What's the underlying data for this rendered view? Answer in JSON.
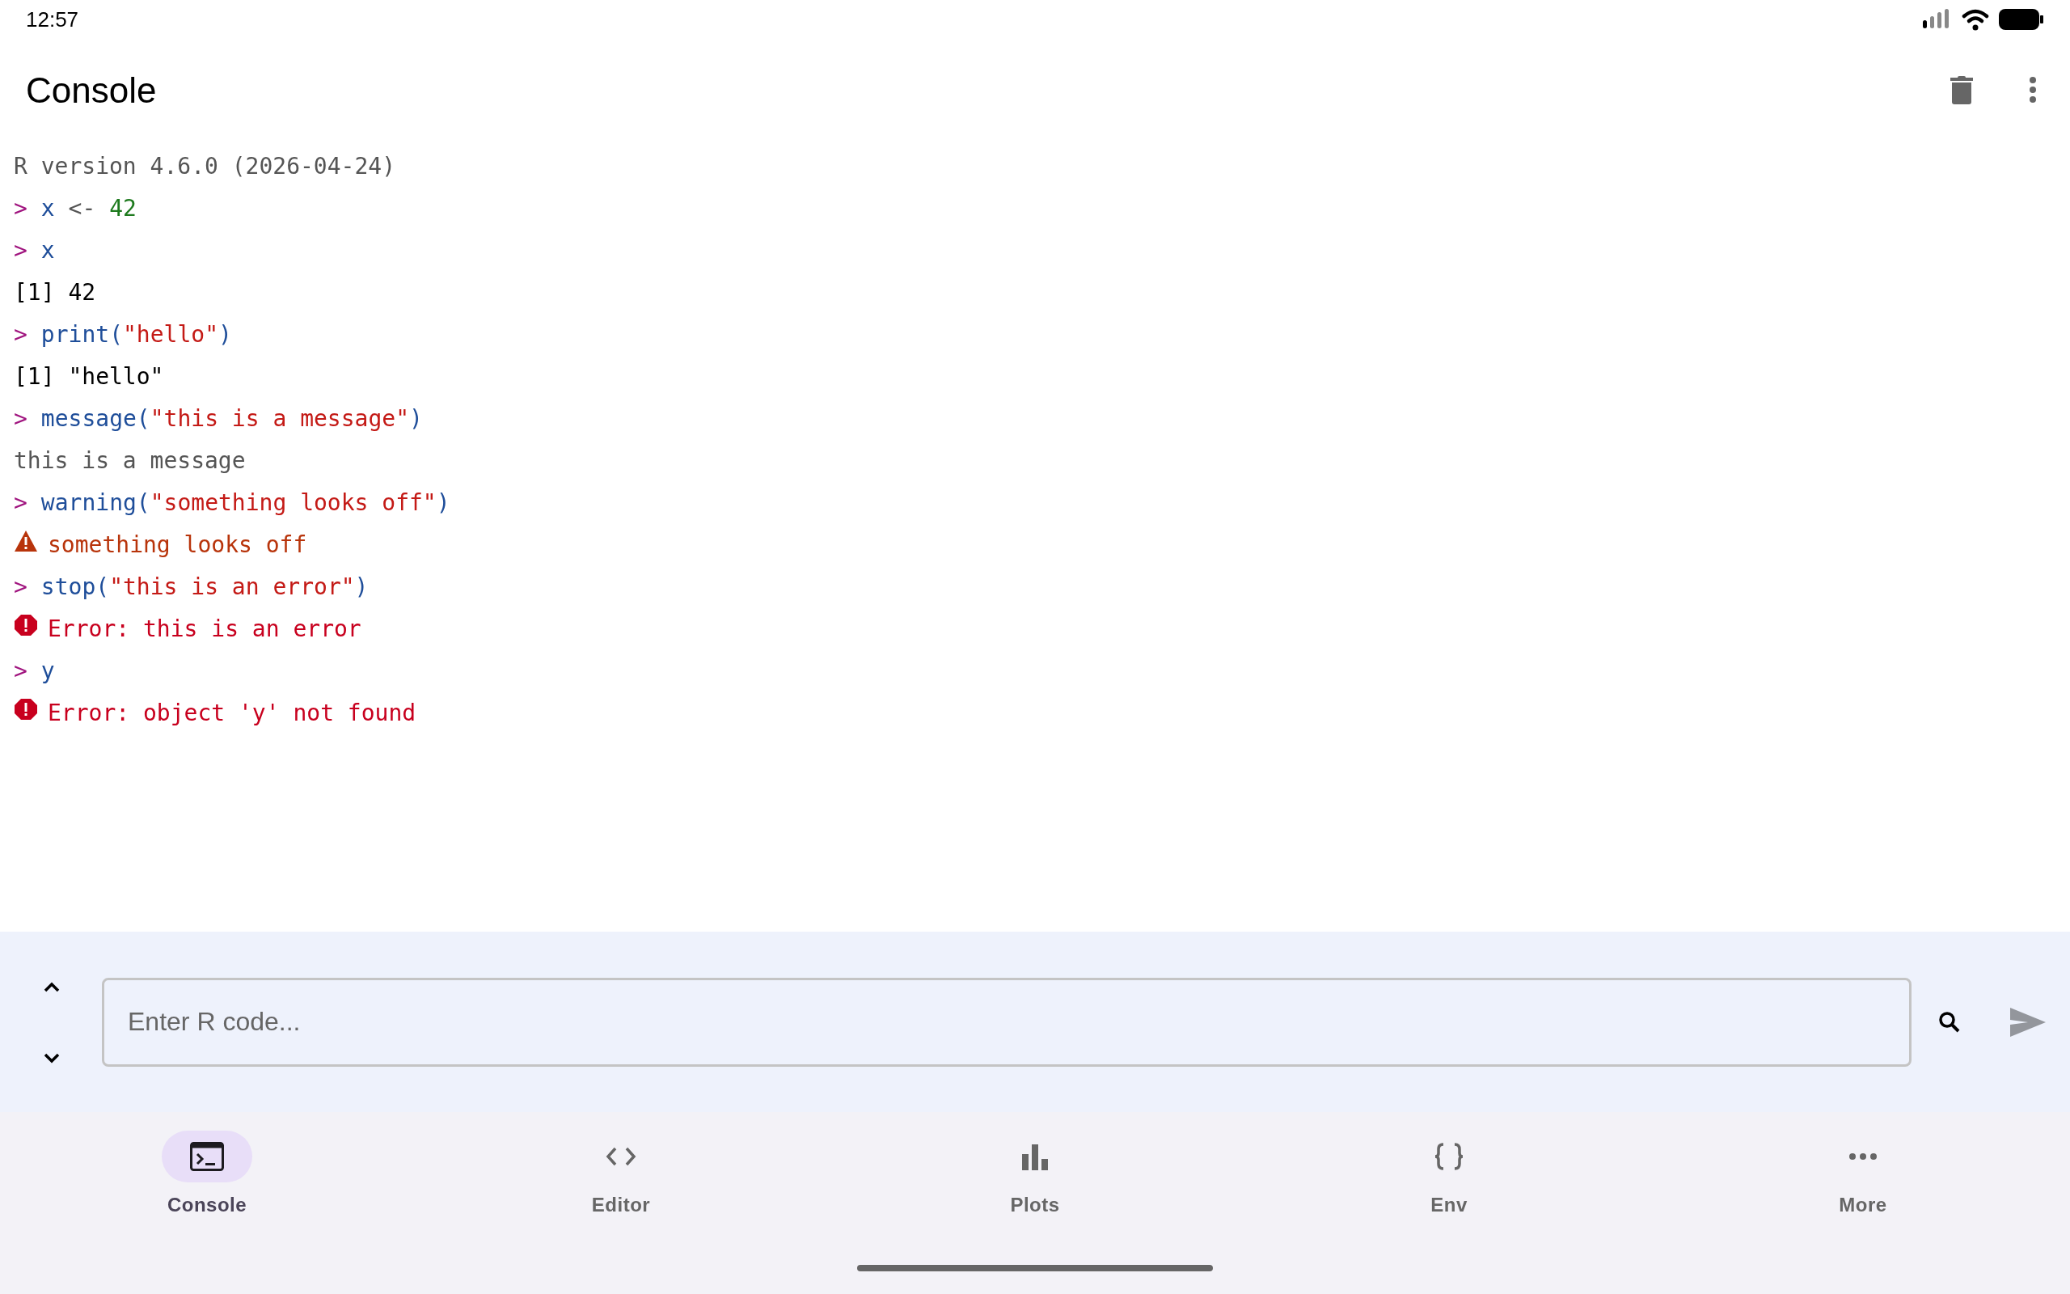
{
  "status_bar": {
    "time": "12:57"
  },
  "app_bar": {
    "title": "Console"
  },
  "console": [
    {
      "kind": "info",
      "text": "R version 4.6.0 (2026-04-24)"
    },
    {
      "kind": "input",
      "prompt": ">",
      "tokens": [
        {
          "kind": "code",
          "text": "x"
        },
        {
          "kind": "op",
          "text": " <- "
        },
        {
          "kind": "number",
          "text": "42"
        }
      ]
    },
    {
      "kind": "input",
      "prompt": ">",
      "tokens": [
        {
          "kind": "code",
          "text": "x"
        }
      ]
    },
    {
      "kind": "output",
      "text": "[1] 42"
    },
    {
      "kind": "input",
      "prompt": ">",
      "tokens": [
        {
          "kind": "code",
          "text": "print("
        },
        {
          "kind": "string",
          "text": "\"hello\""
        },
        {
          "kind": "code",
          "text": ")"
        }
      ]
    },
    {
      "kind": "output",
      "text": "[1] \"hello\""
    },
    {
      "kind": "input",
      "prompt": ">",
      "tokens": [
        {
          "kind": "code",
          "text": "message("
        },
        {
          "kind": "string",
          "text": "\"this is a message\""
        },
        {
          "kind": "code",
          "text": ")"
        }
      ]
    },
    {
      "kind": "message",
      "text": "this is a message"
    },
    {
      "kind": "input",
      "prompt": ">",
      "tokens": [
        {
          "kind": "code",
          "text": "warning("
        },
        {
          "kind": "string",
          "text": "\"something looks off\""
        },
        {
          "kind": "code",
          "text": ")"
        }
      ]
    },
    {
      "kind": "warning",
      "text": "something looks off"
    },
    {
      "kind": "input",
      "prompt": ">",
      "tokens": [
        {
          "kind": "code",
          "text": "stop("
        },
        {
          "kind": "string",
          "text": "\"this is an error\""
        },
        {
          "kind": "code",
          "text": ")"
        }
      ]
    },
    {
      "kind": "error",
      "text": "Error: this is an error"
    },
    {
      "kind": "input",
      "prompt": ">",
      "tokens": [
        {
          "kind": "code",
          "text": "y"
        }
      ]
    },
    {
      "kind": "error",
      "text": "Error: object 'y' not found"
    }
  ],
  "input": {
    "placeholder": "Enter R code..."
  },
  "nav": [
    {
      "label": "Console",
      "selected": true
    },
    {
      "label": "Editor",
      "selected": false
    },
    {
      "label": "Plots",
      "selected": false
    },
    {
      "label": "Env",
      "selected": false
    },
    {
      "label": "More",
      "selected": false
    }
  ]
}
